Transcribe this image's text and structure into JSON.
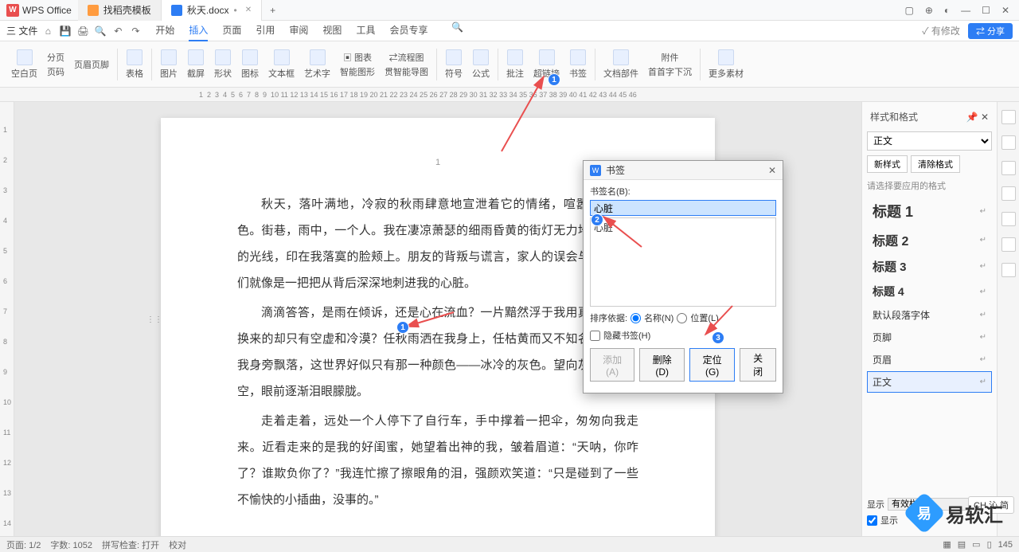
{
  "titlebar": {
    "app_name": "WPS Office",
    "tabs": [
      {
        "label": "找稻壳模板",
        "icon_color": "#ff9b3f"
      },
      {
        "label": "秋天.docx",
        "icon_color": "#2d7df4",
        "dirty": "•"
      }
    ],
    "add": "+"
  },
  "menubar": {
    "file": "三 文件",
    "tabs": [
      "开始",
      "插入",
      "页面",
      "引用",
      "审阅",
      "视图",
      "工具",
      "会员专享"
    ],
    "modified": "✓ 有修改",
    "share": "⇄ 分享"
  },
  "ribbon": {
    "items": [
      "空白页",
      "分页",
      "页码",
      "页眉页脚",
      "表格",
      "图片",
      "截屏",
      "形状",
      "图标",
      "文本框",
      "艺术字",
      "▣ 图表",
      "智能图形",
      "⇄流程图",
      "贯智能导图",
      "附件",
      "符号",
      "公式",
      "批注",
      "超链接",
      "书签",
      "文档部件",
      "首首字下沉",
      "更多素材"
    ]
  },
  "ruler_marks": [
    "1",
    "2",
    "3",
    "4",
    "5",
    "6",
    "7",
    "8",
    "9",
    "10",
    "11",
    "12",
    "13",
    "14",
    "15",
    "16",
    "17",
    "18",
    "19",
    "20",
    "21",
    "22",
    "23",
    "24",
    "25",
    "26",
    "27",
    "28",
    "29",
    "30",
    "31",
    "32",
    "33",
    "34",
    "35",
    "36",
    "37",
    "38",
    "39",
    "40",
    "41",
    "42",
    "43",
    "44",
    "45",
    "46"
  ],
  "vruler": [
    "1",
    "2",
    "3",
    "4",
    "5",
    "6",
    "7",
    "8",
    "9",
    "10",
    "11",
    "12",
    "13",
    "14"
  ],
  "page": {
    "number": "1",
    "paragraphs": [
      "秋天，落叶满地，冷寂的秋雨肆意地宣泄着它的情绪，喧嚣的世界调色。街巷，雨中，一个人。我在凄凉萧瑟的细雨昏黄的街灯无力地洒下冰冷的光线，印在我落寞的脸颊上。朋友的背叛与谎言，家人的误会与训斥，它们就像是一把把从背后深深地刺进我的心脏。",
      "滴滴答答，是雨在倾诉，还是心在流血？一片黯然浮于我用真挚付出的换来的却只有空虚和冷漠？任秋雨洒在我身上，任枯黄而又不知名的叶子从我身旁飘落，这世界好似只有那一种颜色——冰冷的灰色。望向灰濛濛的天空，眼前逐渐泪眼朦胧。",
      "走着走着，远处一个人停下了自行车，手中撑着一把伞，匆匆向我走来。近看走来的是我的好闺蜜，她望着出神的我，皱着眉道：“天呐，你咋了？谁欺负你了？”我连忙擦了擦眼角的泪，强颜欢笑道：“只是碰到了一些不愉快的小插曲，没事的。”"
    ]
  },
  "dialog": {
    "title": "书签",
    "name_label": "书签名(B):",
    "name_value": "心脏",
    "list_items": [
      "心脏"
    ],
    "sort_label": "排序依据:",
    "sort_name": "名称(N)",
    "sort_loc": "位置(L)",
    "hide_label": "隐藏书签(H)",
    "btn_add": "添加(A)",
    "btn_delete": "删除(D)",
    "btn_goto": "定位(G)",
    "btn_close": "关闭"
  },
  "side": {
    "title": "样式和格式",
    "current": "正文",
    "new_style": "新样式",
    "clear": "清除格式",
    "hint": "请选择要应用的格式",
    "items": [
      {
        "label": "标题 1",
        "cls": "h1"
      },
      {
        "label": "标题 2",
        "cls": "h2"
      },
      {
        "label": "标题 3",
        "cls": "h3"
      },
      {
        "label": "标题 4",
        "cls": "h4"
      },
      {
        "label": "默认段落字体",
        "cls": ""
      },
      {
        "label": "页脚",
        "cls": ""
      },
      {
        "label": "页眉",
        "cls": ""
      },
      {
        "label": "正文",
        "cls": "",
        "selected": true
      }
    ],
    "show_label": "显示",
    "show_value": "有效样式",
    "show_check": "显示"
  },
  "status": {
    "page": "页面: 1/2",
    "words": "字数: 1052",
    "spell": "拼写检查: 打开",
    "proof": "校对",
    "zoom": "145"
  },
  "annotations": {
    "n1": "1",
    "n2": "2",
    "n3": "3"
  },
  "watermark": {
    "text": "易软汇"
  },
  "lang": "CH 沁 简"
}
